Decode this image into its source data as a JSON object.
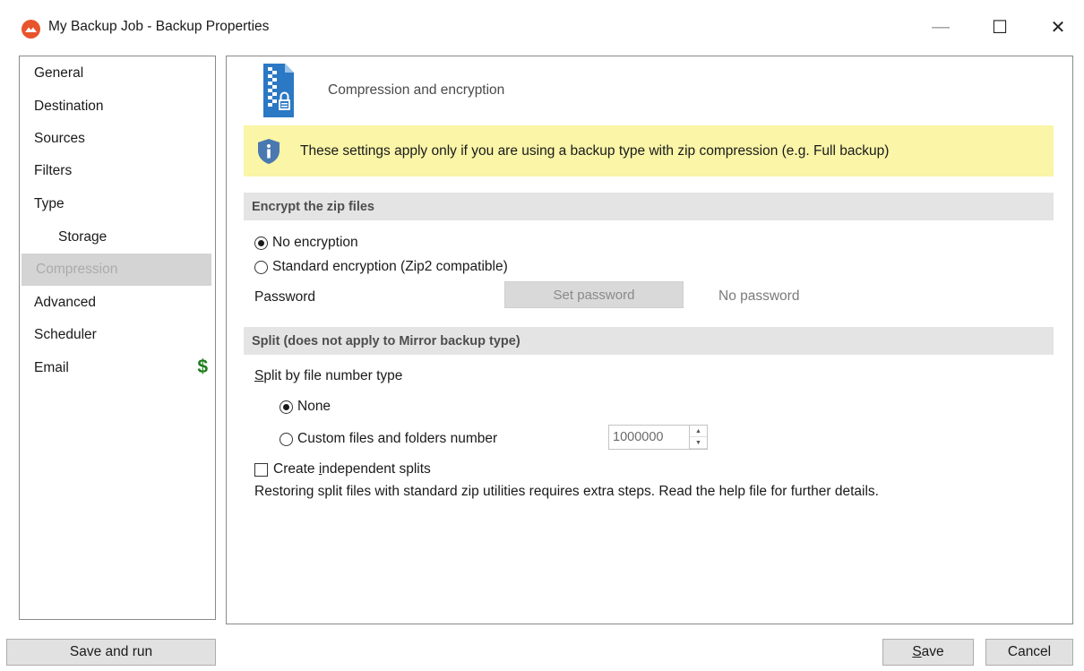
{
  "window": {
    "title": "My Backup Job - Backup Properties",
    "controls": {
      "minimize": "—",
      "maximize": "☐",
      "close": "✕"
    }
  },
  "sidebar": {
    "items": [
      {
        "label": "General"
      },
      {
        "label": "Destination"
      },
      {
        "label": "Sources"
      },
      {
        "label": "Filters"
      },
      {
        "label": "Type"
      },
      {
        "label": "Storage",
        "sub": true
      },
      {
        "label": "Compression",
        "selected": true
      },
      {
        "label": "Advanced"
      },
      {
        "label": "Scheduler"
      },
      {
        "label": "Email",
        "badge": "$"
      }
    ]
  },
  "header": {
    "title": "Compression and encryption",
    "icon": "zip-lock-icon"
  },
  "info": {
    "text": "These settings apply only if you are using a backup type with zip compression (e.g. Full backup)",
    "icon": "shield-info-icon"
  },
  "encrypt": {
    "section_title": "Encrypt the zip files",
    "option_none": "No encryption",
    "option_standard": "Standard encryption (Zip2 compatible)",
    "selected": "none",
    "password_label": "Password",
    "set_password_label": "Set password",
    "password_status": "No password"
  },
  "split": {
    "section_title": "Split (does not apply to Mirror backup type)",
    "type_label_prefix": "S",
    "type_label_rest": "plit by file number type",
    "option_none": "None",
    "option_custom": "Custom files and folders number",
    "selected": "none",
    "custom_value": "1000000",
    "independent_label_a": "Create ",
    "independent_label_u": "i",
    "independent_label_b": "ndependent splits",
    "independent_checked": false,
    "note": "Restoring split files with standard zip utilities requires extra steps. Read the help file for further details."
  },
  "footer": {
    "save_and_run": "Save and run",
    "save_u": "S",
    "save_rest": "ave",
    "cancel": "Cancel"
  },
  "colors": {
    "accent_logo": "#e8542c",
    "info_background": "#faf5a7",
    "icon_blue": "#2b78c4",
    "dollar_green": "#1b7d1b",
    "selected_item_bg": "#d4d4d4"
  }
}
